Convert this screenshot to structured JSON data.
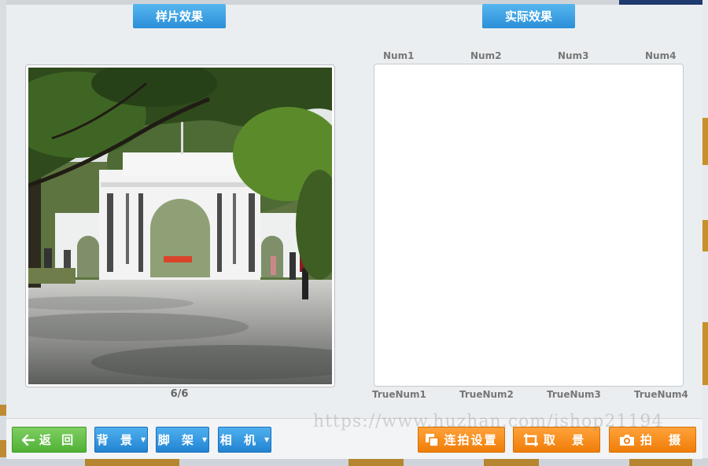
{
  "sample_panel": {
    "title": "样片效果",
    "page_counter": "6/6"
  },
  "actual_panel": {
    "title": "实际效果",
    "num_labels": [
      "Num1",
      "Num2",
      "Num3",
      "Num4"
    ],
    "truenum_labels": [
      "TrueNum1",
      "TrueNum2",
      "TrueNum3",
      "TrueNum4"
    ]
  },
  "toolbar": {
    "back_label": "返 回",
    "background_label": "背 景",
    "tripod_label": "脚 架",
    "camera_label": "相 机",
    "burst_settings_label": "连拍设置",
    "framing_label": "取 景",
    "shoot_label": "拍 摄"
  },
  "watermark": "https://www.huzhan.com/ishop21194",
  "icons": {
    "back": "arrow-left-icon",
    "burst": "copy-icon",
    "framing": "crop-icon",
    "shoot": "camera-icon"
  },
  "colors": {
    "tab_blue": "#2b8fd9",
    "button_green": "#50b236",
    "button_blue": "#2283d3",
    "button_orange": "#f07d08",
    "window_bg": "#ebeef0"
  }
}
